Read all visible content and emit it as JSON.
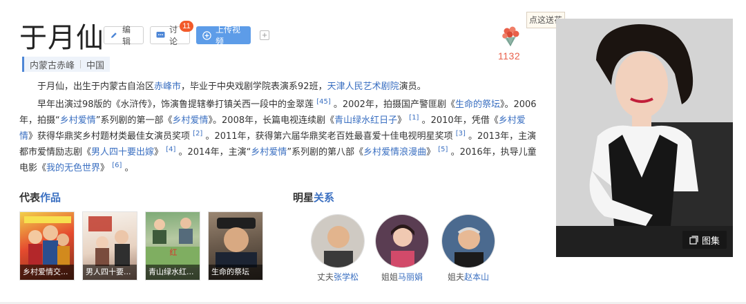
{
  "person": {
    "name": "于月仙"
  },
  "actions": {
    "edit_label": "编辑",
    "discuss_label": "讨论",
    "discuss_count": "11",
    "upload_label": "上传视频",
    "add_label": "+"
  },
  "tags": [
    "内蒙古赤峰",
    "中国"
  ],
  "flower": {
    "tip": "点这送花",
    "count": "1132"
  },
  "summary": {
    "p1": {
      "t1": "于月仙，出生于内蒙古自治区",
      "l1": "赤峰市",
      "t2": "，毕业于中央戏剧学院表演系92班，",
      "l2": "天津人民艺术剧院",
      "t3": "演员。"
    },
    "p2": {
      "t1": "早年出演过98版的《水浒传》，饰演鲁提辖拳打镇关西一段中的金翠莲",
      "r1": "[45]",
      "t2": "。2002年，拍摄国产警匪剧《",
      "l1": "生命的祭坛",
      "t3": "》。2006年，拍摄“",
      "l2": "乡村爱情",
      "t4": "”系列剧的第一部《",
      "l3": "乡村爱情",
      "t5": "》。2008年，长篇电视连续剧《",
      "l4": "青山绿水红日子",
      "t6": "》",
      "r2": "[1]",
      "t7": "。2010年，凭借《",
      "l5": "乡村爱情",
      "t8": "》获得华鼎奖乡村题材类最佳女演员奖项",
      "r3": "[2]",
      "t9": "。2011年，获得第六届华鼎奖老百姓最喜爱十佳电视明星奖项",
      "r4": "[3]",
      "t10": "。2013年，主演都市爱情励志剧《",
      "l6": "男人四十要出嫁",
      "t11": "》",
      "r5": "[4]",
      "t12": "。2014年，主演“",
      "l7": "乡村爱情",
      "t13": "”系列剧的第八部《",
      "l8": "乡村爱情浪漫曲",
      "t14": "》",
      "r6": "[5]",
      "t15": "。2016年，执导儿童电影《",
      "l9": "我的无色世界",
      "t16": "》",
      "r7": "[6]",
      "t17": "。"
    }
  },
  "works": {
    "title_plain": "代表",
    "title_link": "作品",
    "items": [
      {
        "caption": "乡村爱情交..."
      },
      {
        "caption": "男人四十要..."
      },
      {
        "caption": "青山绿水红..."
      },
      {
        "caption": "生命的祭坛"
      }
    ]
  },
  "relations": {
    "title_plain": "明星",
    "title_link": "关系",
    "items": [
      {
        "relation": "丈夫",
        "name": "张学松"
      },
      {
        "relation": "姐姐",
        "name": "马丽娟"
      },
      {
        "relation": "姐夫",
        "name": "赵本山"
      }
    ]
  },
  "gallery_label": "图集",
  "colors": {
    "accent": "#3a6fc1",
    "upload_button": "#5d9ce8",
    "badge": "#f25a2a",
    "flower_count": "#e9604a"
  }
}
